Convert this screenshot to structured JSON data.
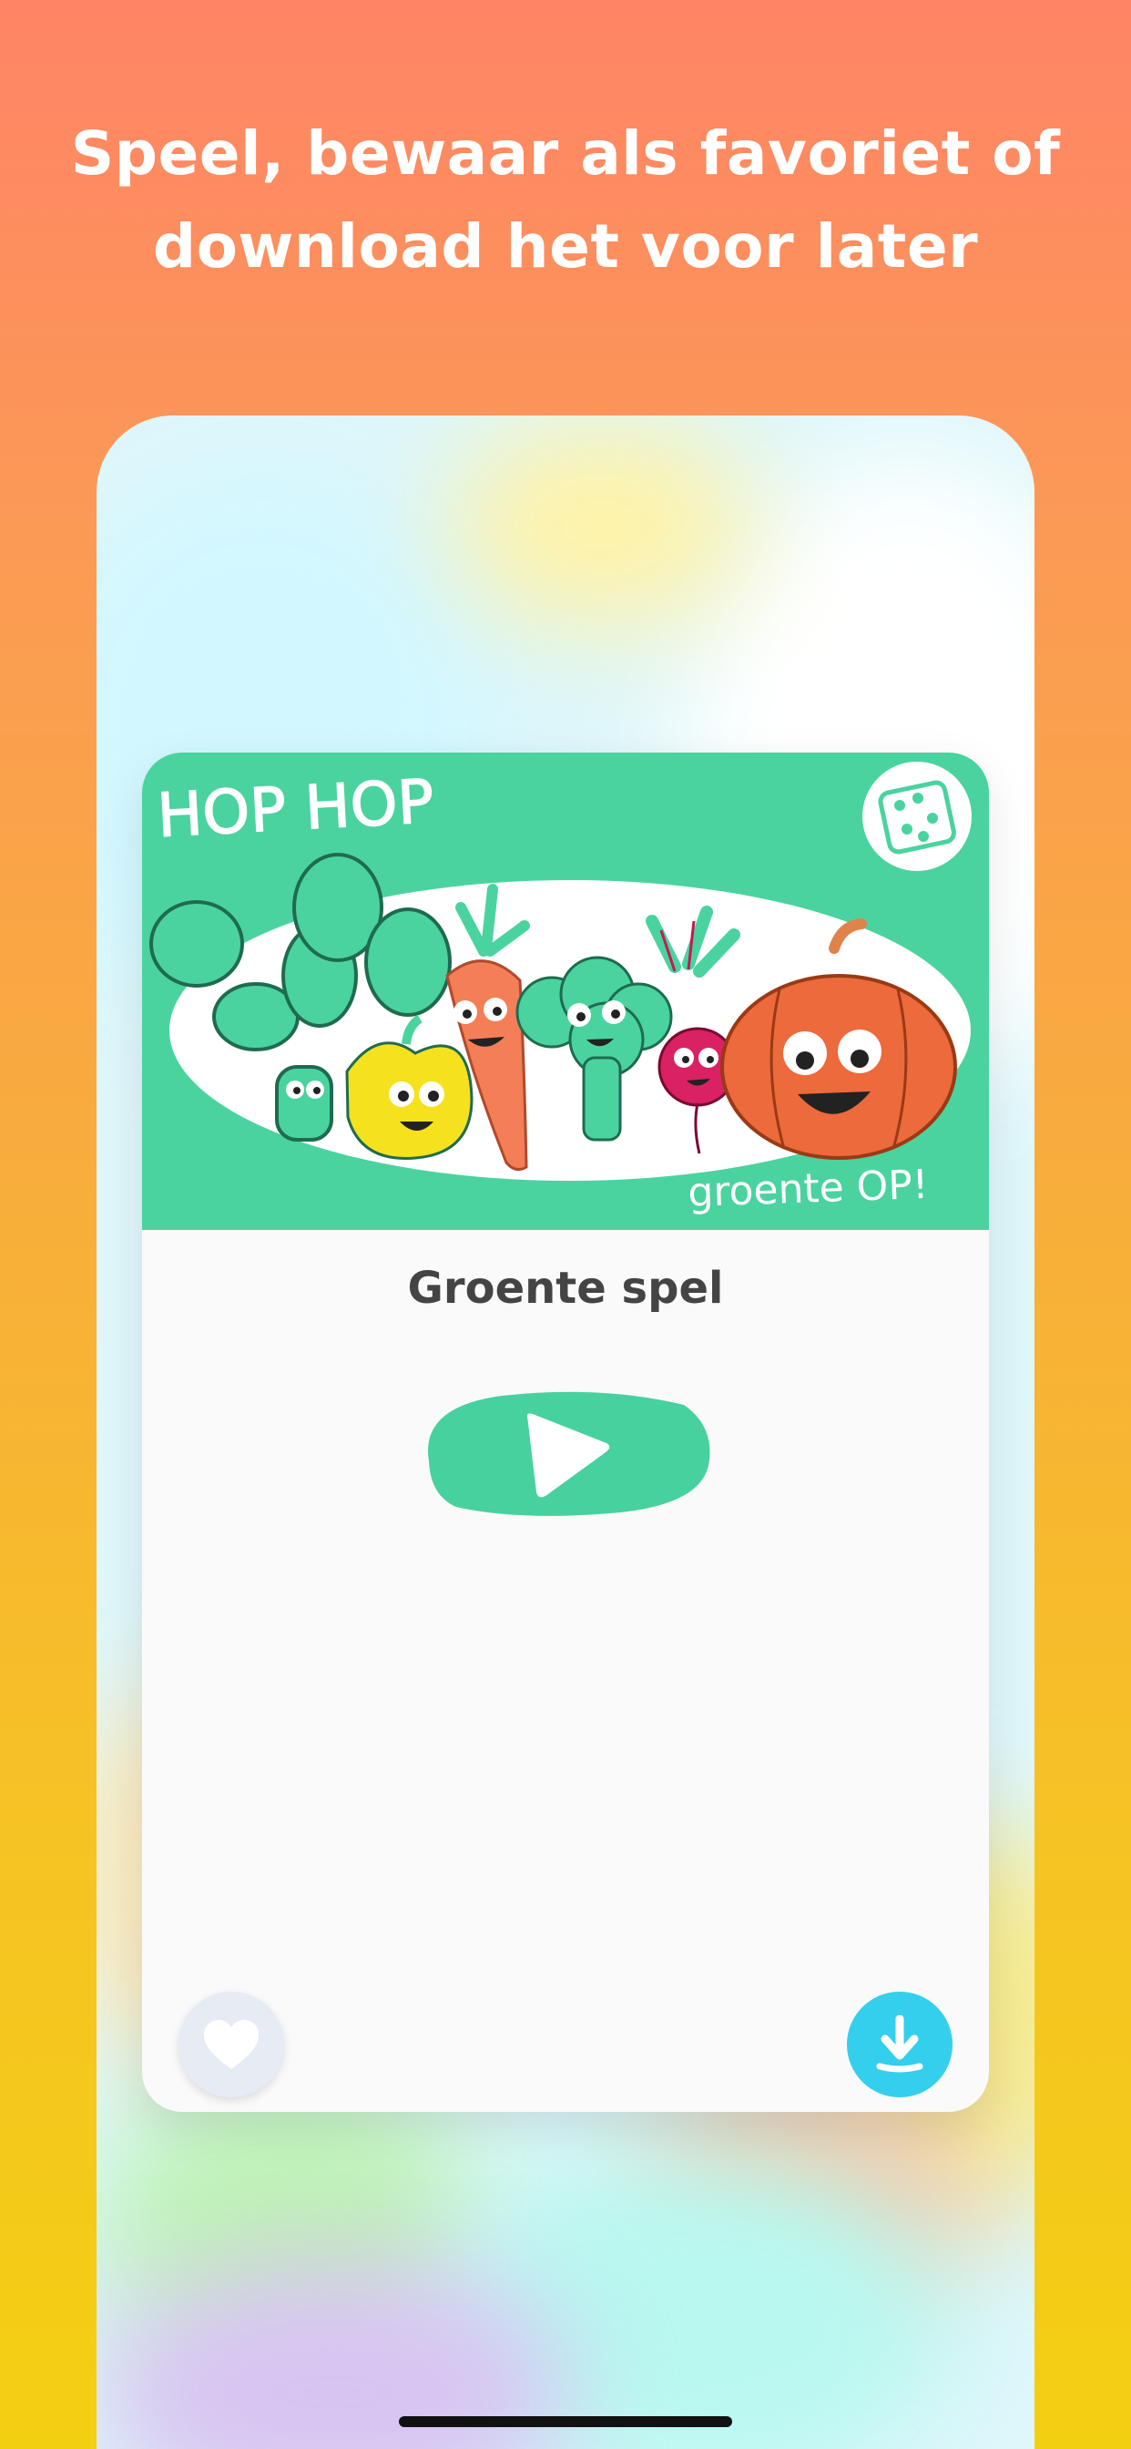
{
  "headline": {
    "line1": "Speel, bewaar als favoriet of",
    "line2": "download het voor later"
  },
  "card": {
    "image_text_top": "HOP HOP",
    "image_text_bottom": "groente OP!",
    "title": "Groente spel"
  },
  "icons": {
    "dice": "dice-icon",
    "play": "play-icon",
    "favorite": "heart-icon",
    "download": "download-icon"
  },
  "colors": {
    "accent_green": "#4ad39f",
    "download_blue": "#35cfee",
    "heart_bg": "#e6ebf4",
    "title_text": "#444444"
  }
}
